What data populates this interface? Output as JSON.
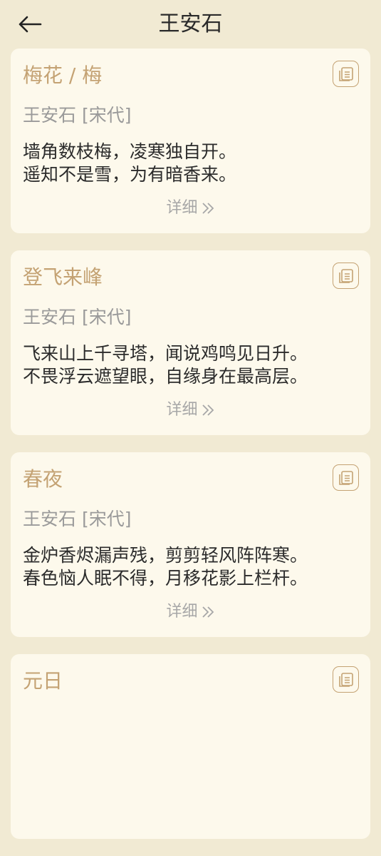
{
  "header": {
    "title": "王安石",
    "back_icon": "arrow-left-icon"
  },
  "poems": [
    {
      "title": "梅花 / 梅",
      "author": "王安石 [宋代]",
      "lines": [
        "墙角数枝梅，凌寒独自开。",
        "遥知不是雪，为有暗香来。"
      ],
      "detail_label": "详细"
    },
    {
      "title": "登飞来峰",
      "author": "王安石 [宋代]",
      "lines": [
        "飞来山上千寻塔，闻说鸡鸣见日升。",
        "不畏浮云遮望眼，自缘身在最高层。"
      ],
      "detail_label": "详细"
    },
    {
      "title": "春夜",
      "author": "王安石 [宋代]",
      "lines": [
        "金炉香烬漏声残，剪剪轻风阵阵寒。",
        "春色恼人眠不得，月移花影上栏杆。"
      ],
      "detail_label": "详细"
    },
    {
      "title": "元日",
      "author": "",
      "lines": [
        "",
        ""
      ],
      "detail_label": ""
    }
  ],
  "colors": {
    "background": "#f1ead3",
    "card": "#fdf9ec",
    "accent": "#c4a273"
  }
}
